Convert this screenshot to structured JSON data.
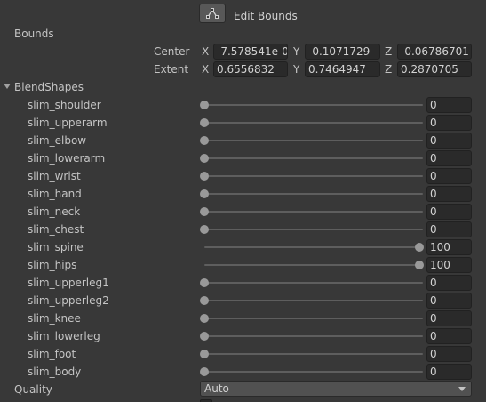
{
  "edit_bounds": {
    "label": "Edit Bounds",
    "icon": "edit-bounds-icon"
  },
  "bounds": {
    "title": "Bounds",
    "center": {
      "label": "Center",
      "x": "-7.578541e-0",
      "y": "-0.1071729",
      "z": "-0.06786701"
    },
    "extent": {
      "label": "Extent",
      "x": "0.6556832",
      "y": "0.7464947",
      "z": "0.2870705"
    },
    "axes": {
      "x": "X",
      "y": "Y",
      "z": "Z"
    }
  },
  "blendshapes": {
    "title": "BlendShapes",
    "slider_max": 100,
    "items": [
      {
        "name": "slim_shoulder",
        "value": "0"
      },
      {
        "name": "slim_upperarm",
        "value": "0"
      },
      {
        "name": "slim_elbow",
        "value": "0"
      },
      {
        "name": "slim_lowerarm",
        "value": "0"
      },
      {
        "name": "slim_wrist",
        "value": "0"
      },
      {
        "name": "slim_hand",
        "value": "0"
      },
      {
        "name": "slim_neck",
        "value": "0"
      },
      {
        "name": "slim_chest",
        "value": "0"
      },
      {
        "name": "slim_spine",
        "value": "100"
      },
      {
        "name": "slim_hips",
        "value": "100"
      },
      {
        "name": "slim_upperleg1",
        "value": "0"
      },
      {
        "name": "slim_upperleg2",
        "value": "0"
      },
      {
        "name": "slim_knee",
        "value": "0"
      },
      {
        "name": "slim_lowerleg",
        "value": "0"
      },
      {
        "name": "slim_foot",
        "value": "0"
      },
      {
        "name": "slim_body",
        "value": "0"
      }
    ]
  },
  "quality": {
    "label": "Quality",
    "value": "Auto"
  }
}
